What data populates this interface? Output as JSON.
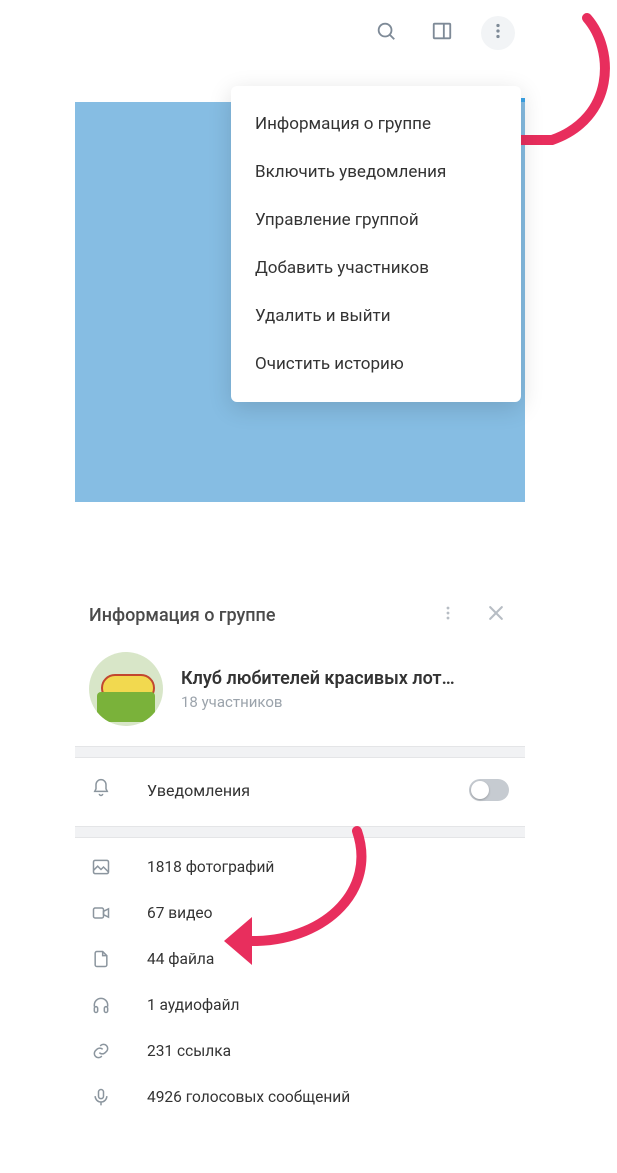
{
  "toolbar": {
    "search_icon": "search-icon",
    "sidebar_icon": "sidebar-icon",
    "more_icon": "more-icon"
  },
  "menu": {
    "items": [
      "Информация о группе",
      "Включить  уведомления",
      "Управление группой",
      "Добавить участников",
      "Удалить и выйти",
      "Очистить историю"
    ]
  },
  "info": {
    "title": "Информация о группе",
    "group_name": "Клуб любителей красивых лот…",
    "members": "18 участников",
    "notifications_label": "Уведомления",
    "notifications_on": false,
    "media": [
      {
        "icon": "photo-icon",
        "label": "1818 фотографий"
      },
      {
        "icon": "video-icon",
        "label": "67 видео"
      },
      {
        "icon": "file-icon",
        "label": "44 файла"
      },
      {
        "icon": "audio-icon",
        "label": "1 аудиофайл"
      },
      {
        "icon": "link-icon",
        "label": "231 ссылка"
      },
      {
        "icon": "voice-icon",
        "label": "4926 голосовых сообщений"
      }
    ]
  },
  "colors": {
    "accent_arrow": "#e82e5d",
    "blue_bg": "#86bde3"
  }
}
